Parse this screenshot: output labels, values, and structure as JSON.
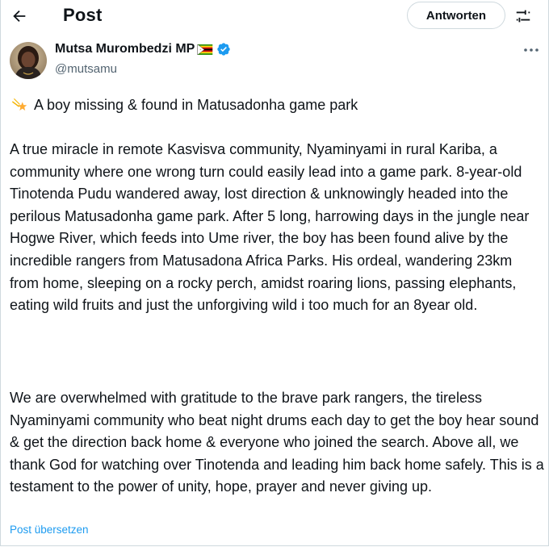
{
  "header": {
    "title": "Post",
    "back_icon": "arrow-left-icon",
    "reply_label": "Antworten",
    "filter_icon": "sliders-icon"
  },
  "author": {
    "name": "Mutsa Murombedzi MP",
    "handle": "@mutsamu",
    "flag_icon": "zimbabwe-flag-icon",
    "verified_icon": "verified-badge-icon",
    "more_icon": "more-horizontal-icon"
  },
  "post": {
    "headline_icon": "shooting-star-icon",
    "headline": "A boy missing & found in Matusadonha game park",
    "paragraphs": [
      "A true miracle in remote Kasvisva community, Nyaminyami in rural Kariba, a community where one wrong turn could easily lead into a game park.  8-year-old Tinotenda Pudu wandered away, lost direction & unknowingly headed into the perilous Matusadonha game park. After 5 long, harrowing days in the jungle near Hogwe River, which feeds into Ume river, the boy has been found alive by the incredible rangers from Matusadona Africa Parks. His ordeal, wandering 23km from home, sleeping on a rocky perch, amidst roaring lions, passing elephants, eating wild fruits and just the unforgiving wild i too much for an 8year old.",
      "We are overwhelmed with gratitude to the brave park rangers, the tireless Nyaminyami community who beat night drums each day to get the boy hear sound & get the direction back home & everyone who joined the search. Above all, we thank God for watching over Tinotenda and leading him back home safely. This is a testament to the power of unity, hope, prayer and never giving up."
    ],
    "translate_label": "Post übersetzen"
  },
  "colors": {
    "accent": "#1d9bf0",
    "text": "#0f1419",
    "secondary": "#536471",
    "border": "#cfd9de"
  }
}
